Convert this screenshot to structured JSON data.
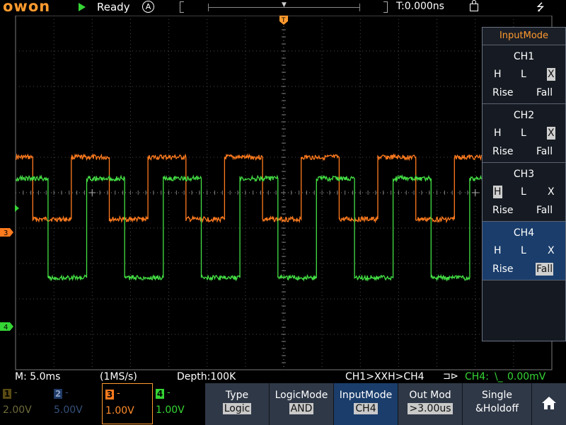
{
  "header": {
    "brand": "owon",
    "status": "Ready",
    "acq_mode_icon": "A",
    "trigger_time": "T:0.000ns",
    "icons": [
      "run-icon",
      "auto-mode-icon",
      "lock-icon",
      "usb-icon"
    ]
  },
  "side_menu": {
    "title": "InputMode",
    "channels": [
      {
        "name": "CH1",
        "h": "H",
        "l": "L",
        "x": "X",
        "rise": "Rise",
        "fall": "Fall",
        "selected": "X"
      },
      {
        "name": "CH2",
        "h": "H",
        "l": "L",
        "x": "X",
        "rise": "Rise",
        "fall": "Fall",
        "selected": "X"
      },
      {
        "name": "CH3",
        "h": "H",
        "l": "L",
        "x": "X",
        "rise": "Rise",
        "fall": "Fall",
        "selected": "H"
      },
      {
        "name": "CH4",
        "h": "H",
        "l": "L",
        "x": "X",
        "rise": "Rise",
        "fall": "Fall",
        "selected": "Fall"
      }
    ]
  },
  "info": {
    "timebase": "M: 5.0ms",
    "sample_rate": "(1MS/s)",
    "depth": "Depth:100K",
    "trigger_cond": "CH1>XXH>CH4",
    "trigger_channel": "CH4:",
    "trigger_level": "0.00mV"
  },
  "channels": [
    {
      "num": "1",
      "dash": "-",
      "volt": "2.00V"
    },
    {
      "num": "2",
      "dash": "-",
      "volt": "5.00V"
    },
    {
      "num": "3",
      "dash": "-",
      "volt": "1.00V"
    },
    {
      "num": "4",
      "dash": "-",
      "volt": "1.00V"
    }
  ],
  "menu": [
    {
      "label": "Type",
      "value": "Logic"
    },
    {
      "label": "LogicMode",
      "value": "AND"
    },
    {
      "label": "InputMode",
      "value": "CH4"
    },
    {
      "label": "Out Mod",
      "value": ">3.00us"
    },
    {
      "label": "Single",
      "value": "&Holdoff"
    }
  ],
  "markers": {
    "ch3": "3",
    "ch4": "4",
    "trigger": "T"
  },
  "waveforms": {
    "ch3": {
      "color": "#ff7b1e",
      "high_div": 1.0,
      "low_div": -0.75,
      "period_ms": 10.0,
      "first_rise_ms": -17.8,
      "duty": 0.5
    },
    "ch4": {
      "color": "#44e044",
      "high_div": 0.4,
      "low_div": -2.4,
      "period_ms": 10.0,
      "first_rise_ms": -15.8,
      "duty": 0.5
    }
  },
  "colors": {
    "accent": "#ff9a2e",
    "ch3": "#ff7b1e",
    "ch4": "#35d535",
    "active": "#1a3d6b"
  }
}
